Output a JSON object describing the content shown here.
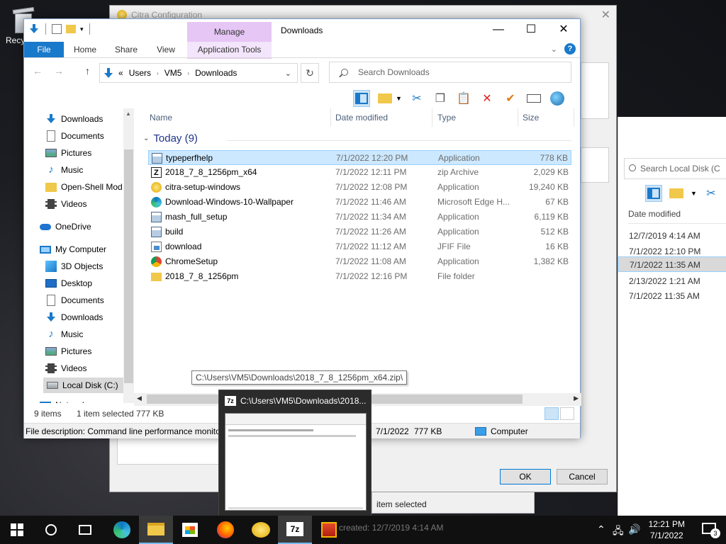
{
  "desktop": {
    "recycle_label": "Recy"
  },
  "citra": {
    "title": "Citra Configuration",
    "ok": "OK",
    "cancel": "Cancel"
  },
  "explorer_back": {
    "search_placeholder": "Search Local Disk (C",
    "date_header": "Date modified",
    "dates": [
      "12/7/2019 4:14 AM",
      "7/1/2022 12:10 PM",
      "7/1/2022 11:35 AM",
      "2/13/2022 1:21 AM",
      "7/1/2022 11:35 AM"
    ],
    "sel_index": 2
  },
  "window": {
    "title": "Downloads",
    "manage": "Manage",
    "controls": {
      "minimize": "—",
      "maximize": "☐",
      "close": "✕"
    },
    "tabs": {
      "file": "File",
      "home": "Home",
      "share": "Share",
      "view": "View",
      "app_tools": "Application Tools"
    },
    "address": {
      "prefix": "«",
      "parts": [
        "Users",
        "VM5",
        "Downloads"
      ]
    },
    "search_placeholder": "Search Downloads"
  },
  "nav": [
    {
      "label": "Downloads",
      "icon": "download-icon",
      "pinned": true
    },
    {
      "label": "Documents",
      "icon": "document-icon",
      "pinned": true
    },
    {
      "label": "Pictures",
      "icon": "pictures-icon",
      "pinned": true
    },
    {
      "label": "Music",
      "icon": "music-icon",
      "pinned": false
    },
    {
      "label": "Open-Shell Mod",
      "icon": "folder-icon",
      "pinned": false
    },
    {
      "label": "Videos",
      "icon": "video-icon",
      "pinned": false
    },
    {
      "label": "OneDrive",
      "icon": "onedrive-icon",
      "pinned": false
    },
    {
      "label": "My Computer",
      "icon": "computer-icon",
      "pinned": false
    },
    {
      "label": "3D Objects",
      "icon": "3d-objects-icon",
      "pinned": false
    },
    {
      "label": "Desktop",
      "icon": "desktop-icon",
      "pinned": false
    },
    {
      "label": "Documents",
      "icon": "document-icon",
      "pinned": false
    },
    {
      "label": "Downloads",
      "icon": "download-icon",
      "pinned": false
    },
    {
      "label": "Music",
      "icon": "music-icon",
      "pinned": false
    },
    {
      "label": "Pictures",
      "icon": "pictures-icon",
      "pinned": false
    },
    {
      "label": "Videos",
      "icon": "video-icon",
      "pinned": false
    },
    {
      "label": "Local Disk (C:)",
      "icon": "disk-icon",
      "pinned": false
    },
    {
      "label": "Network",
      "icon": "network-icon",
      "pinned": false
    }
  ],
  "columns": {
    "name": "Name",
    "date": "Date modified",
    "type": "Type",
    "size": "Size"
  },
  "group": "Today (9)",
  "files": [
    {
      "name": "typeperfhelp",
      "date": "7/1/2022 12:20 PM",
      "type": "Application",
      "size": "778 KB",
      "icon": "app"
    },
    {
      "name": "2018_7_8_1256pm_x64",
      "date": "7/1/2022 12:11 PM",
      "type": "zip Archive",
      "size": "2,029 KB",
      "icon": "zip"
    },
    {
      "name": "citra-setup-windows",
      "date": "7/1/2022 12:08 PM",
      "type": "Application",
      "size": "19,240 KB",
      "icon": "coin"
    },
    {
      "name": "Download-Windows-10-Wallpaper",
      "date": "7/1/2022 11:46 AM",
      "type": "Microsoft Edge H...",
      "size": "67 KB",
      "icon": "edge"
    },
    {
      "name": "mash_full_setup",
      "date": "7/1/2022 11:34 AM",
      "type": "Application",
      "size": "6,119 KB",
      "icon": "app"
    },
    {
      "name": "build",
      "date": "7/1/2022 11:26 AM",
      "type": "Application",
      "size": "512 KB",
      "icon": "app"
    },
    {
      "name": "download",
      "date": "7/1/2022 11:12 AM",
      "type": "JFIF File",
      "size": "16 KB",
      "icon": "img"
    },
    {
      "name": "ChromeSetup",
      "date": "7/1/2022 11:08 AM",
      "type": "Application",
      "size": "1,382 KB",
      "icon": "chrome"
    },
    {
      "name": "2018_7_8_1256pm",
      "date": "7/1/2022 12:16 PM",
      "type": "File folder",
      "size": "",
      "icon": "fold"
    }
  ],
  "tooltip": "C:\\Users\\VM5\\Downloads\\2018_7_8_1256pm_x64.zip\\",
  "status": {
    "items": "9 items",
    "selected": "1 item selected  777 KB"
  },
  "desc": {
    "text": "File description: Command line performance monito",
    "date": "7/1/2022",
    "size": "777 KB",
    "location": "Computer"
  },
  "preview": {
    "title": "C:\\Users\\VM5\\Downloads\\2018..."
  },
  "behind": {
    "item_selected": "item selected",
    "created": "created: 12/7/2019 4:14 AM"
  },
  "tray": {
    "time": "12:21 PM",
    "date": "7/1/2022",
    "notifications": "3"
  }
}
